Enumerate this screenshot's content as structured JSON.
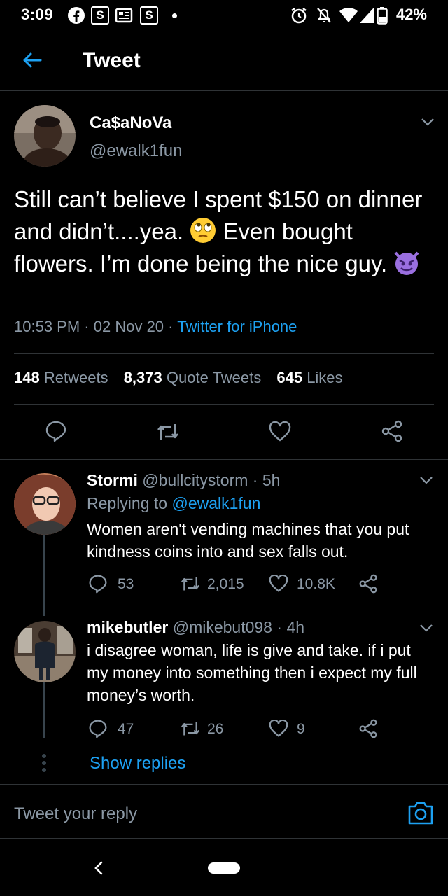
{
  "status_bar": {
    "time": "3:09",
    "battery": "42%"
  },
  "header": {
    "title": "Tweet"
  },
  "tweet": {
    "author_name": "Ca$aNoVa",
    "author_handle": "@ewalk1fun",
    "text_1": "Still can’t believe I spent $150 on dinner and didn’t....yea.",
    "text_2": "Even bought flowers. I’m done being the nice guy.",
    "time": "10:53 PM",
    "date": "02 Nov 20",
    "source": "Twitter for iPhone",
    "retweets_count": "148",
    "retweets_label": "Retweets",
    "quotes_count": "8,373",
    "quotes_label": "Quote Tweets",
    "likes_count": "645",
    "likes_label": "Likes"
  },
  "replies": [
    {
      "name": "Stormi",
      "handle": "@bullcitystorm",
      "age": "5h",
      "replying_prefix": "Replying to",
      "replying_to": "@ewalk1fun",
      "text": "Women aren't vending machines that you put kindness coins into and sex falls out.",
      "replies": "53",
      "retweets": "2,015",
      "likes": "10.8K"
    },
    {
      "name": "mikebutler",
      "handle": "@mikebut098",
      "age": "4h",
      "text": "i disagree woman, life is give and take. if i put my money into something then i expect my full money’s worth.",
      "replies": "47",
      "retweets": "26",
      "likes": "9"
    }
  ],
  "show_replies": "Show replies",
  "reply_input": {
    "placeholder": "Tweet your reply"
  },
  "colors": {
    "accent": "#1da1f2",
    "muted": "#8b98a5",
    "background": "#000000",
    "divider": "#2f3336"
  }
}
